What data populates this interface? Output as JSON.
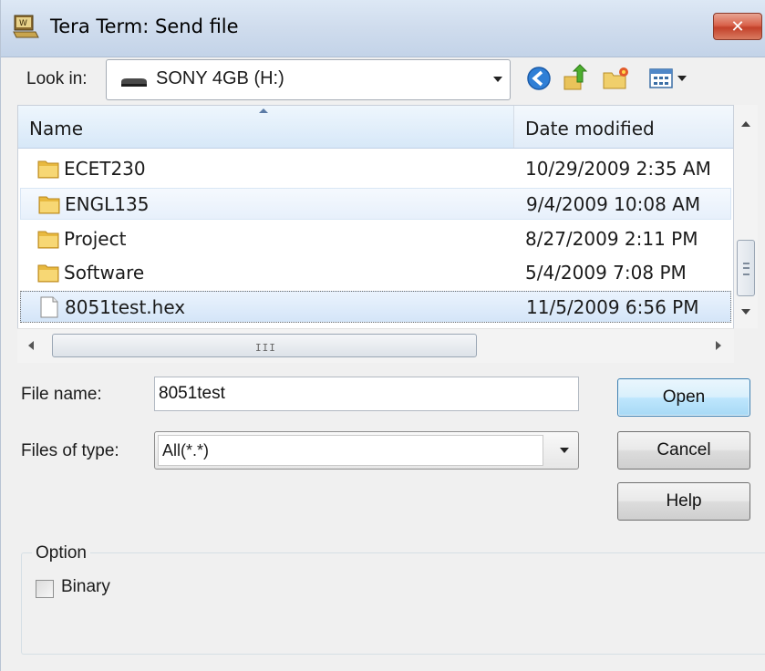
{
  "window": {
    "title": "Tera Term: Send file",
    "close_glyph": "✕"
  },
  "lookin": {
    "label": "Look in:",
    "value": "SONY 4GB (H:)"
  },
  "toolbar": {
    "icons": [
      "back-icon",
      "up-folder-icon",
      "new-folder-icon",
      "view-menu-icon"
    ]
  },
  "filelist": {
    "columns": [
      "Name",
      "Date modified"
    ],
    "rows": [
      {
        "name": "ECET230",
        "date": "10/29/2009 2:35 AM",
        "type": "folder"
      },
      {
        "name": "ENGL135",
        "date": "9/4/2009 10:08 AM",
        "type": "folder"
      },
      {
        "name": "Project",
        "date": "8/27/2009 2:11 PM",
        "type": "folder"
      },
      {
        "name": "Software",
        "date": "5/4/2009 7:08 PM",
        "type": "folder"
      },
      {
        "name": "8051test.hex",
        "date": "11/5/2009 6:56 PM",
        "type": "file"
      }
    ],
    "hscroll_grip": "III"
  },
  "form": {
    "filename_label": "File name:",
    "filename_value": "8051test",
    "filetype_label": "Files of type:",
    "filetype_value": "All(*.*)"
  },
  "buttons": {
    "open": "Open",
    "cancel": "Cancel",
    "help": "Help"
  },
  "option": {
    "group_title": "Option",
    "binary_label": "Binary",
    "binary_checked": false
  },
  "colors": {
    "selection": "#d4e5f8",
    "default_button": "#bee6fd",
    "close_button": "#c3412a"
  }
}
